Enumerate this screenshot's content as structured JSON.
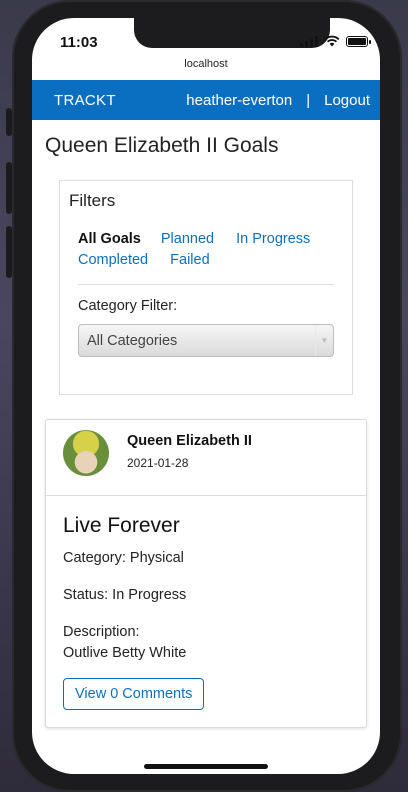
{
  "status": {
    "time": "11:03"
  },
  "browser": {
    "url": "localhost"
  },
  "navbar": {
    "brand": "TRACKT",
    "username": "heather-everton",
    "separator": "|",
    "logout": "Logout"
  },
  "page": {
    "title": "Queen Elizabeth II Goals"
  },
  "filters": {
    "heading": "Filters",
    "links": [
      {
        "label": "All Goals",
        "active": true
      },
      {
        "label": "Planned",
        "active": false
      },
      {
        "label": "In Progress",
        "active": false
      },
      {
        "label": "Completed",
        "active": false
      },
      {
        "label": "Failed",
        "active": false
      }
    ],
    "category_label": "Category Filter:",
    "category_selected": "All Categories"
  },
  "goal": {
    "owner": "Queen Elizabeth II",
    "date": "2021-01-28",
    "title": "Live Forever",
    "category": "Category: Physical",
    "status": "Status: In Progress",
    "description_label": "Description:",
    "description": "Outlive Betty White",
    "comments_button": "View 0 Comments"
  },
  "colors": {
    "primary": "#0b6fc1"
  }
}
